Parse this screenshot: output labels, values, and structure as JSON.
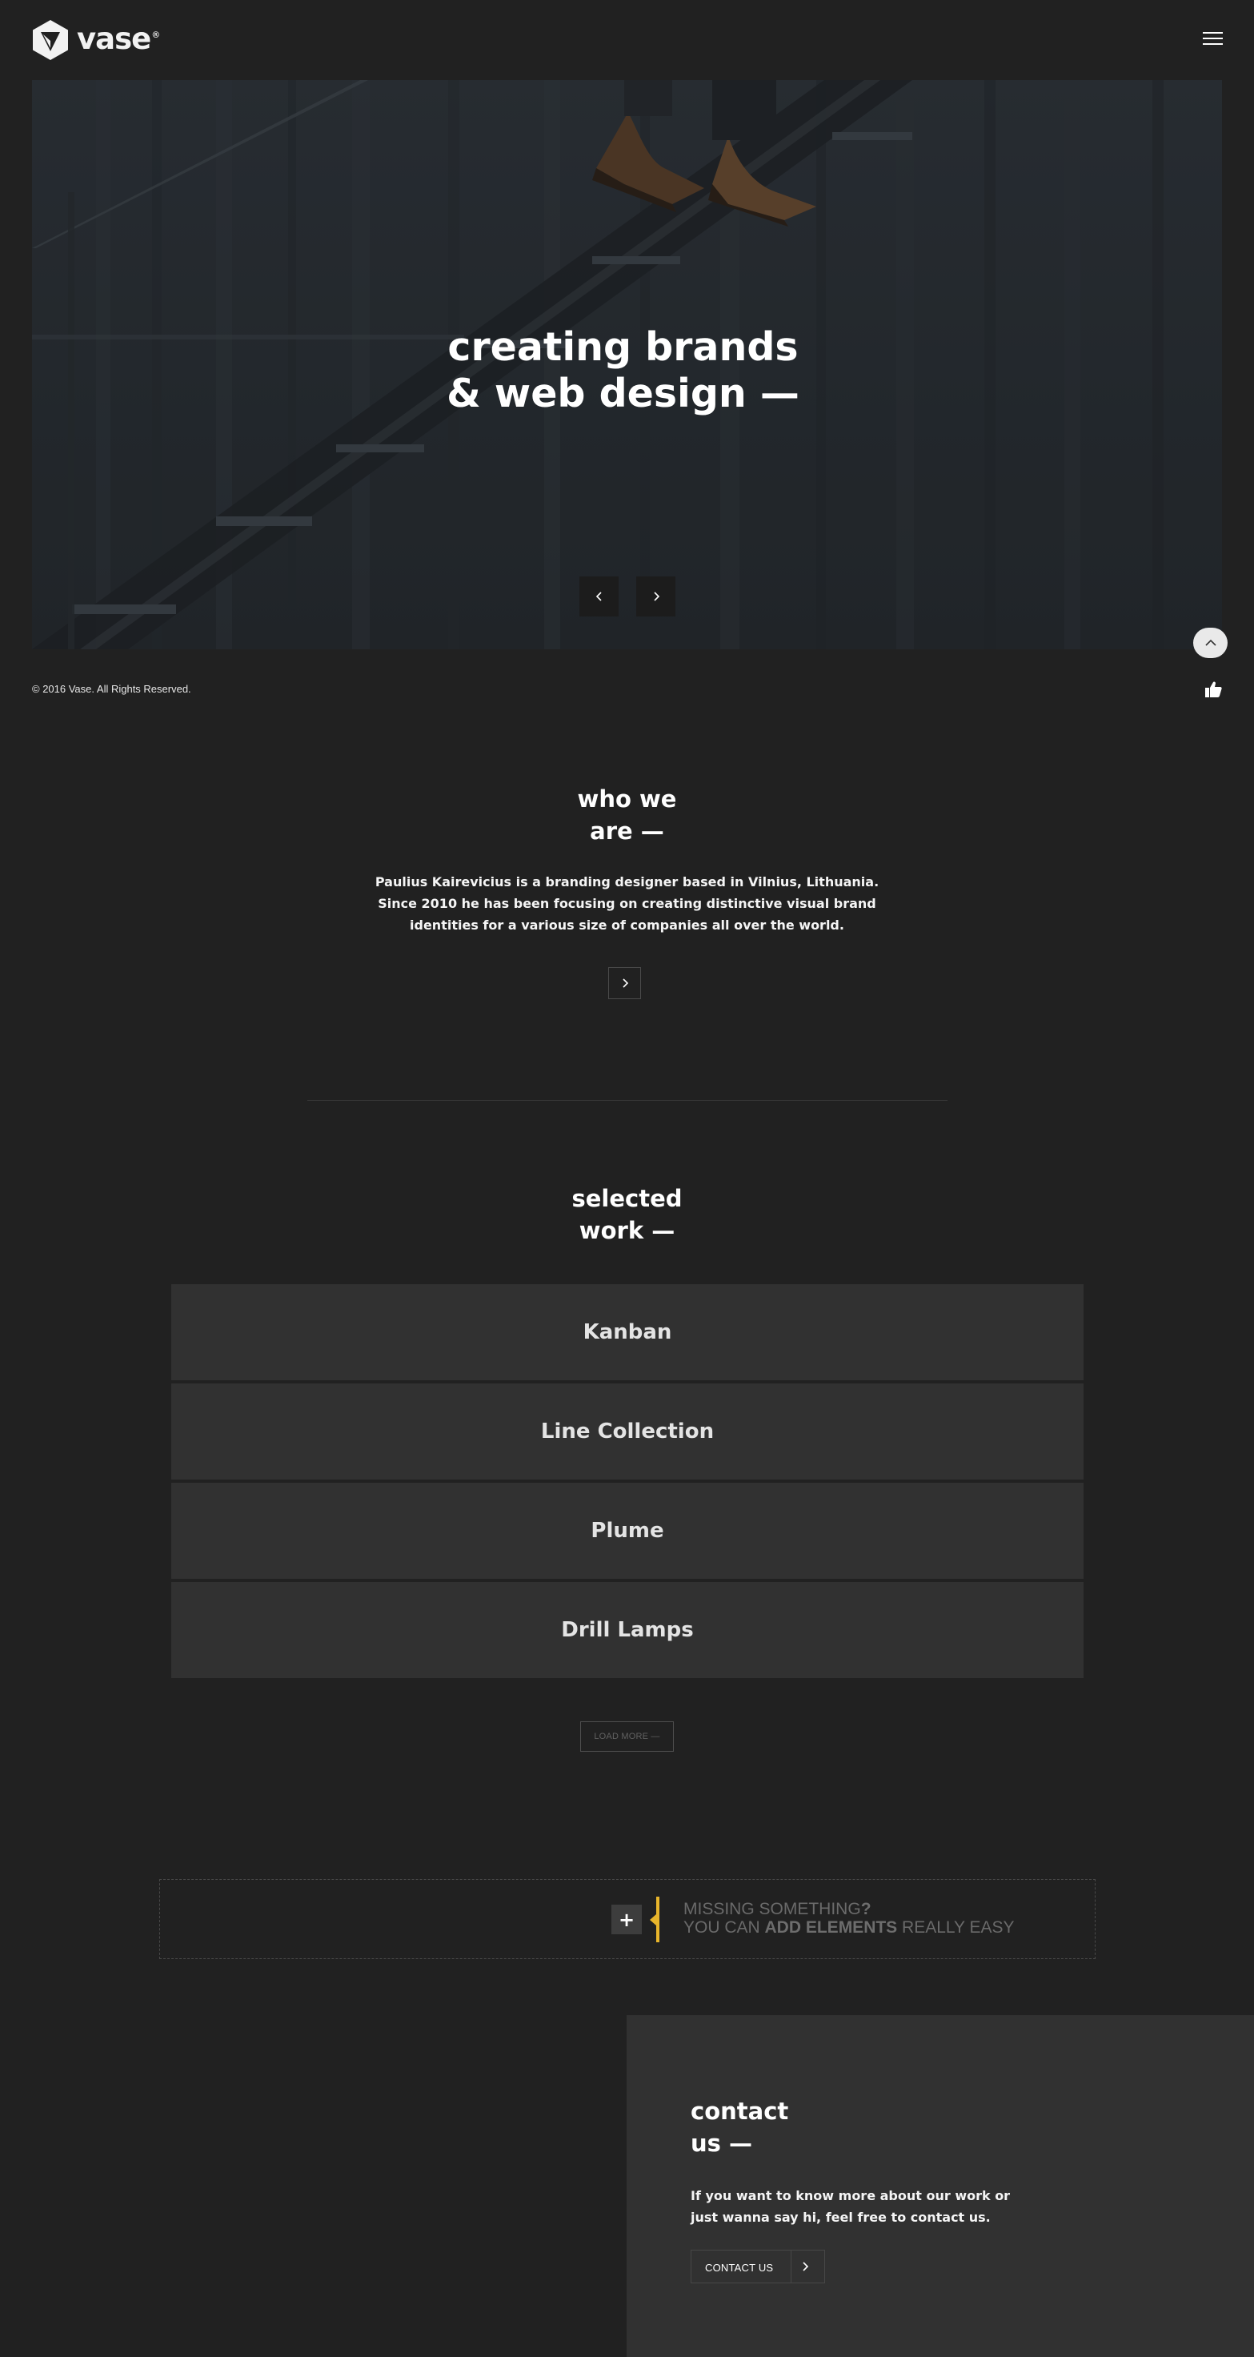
{
  "brand": {
    "name": "vase",
    "reg_mark": "®"
  },
  "hero": {
    "title_line1": "creating brands",
    "title_line2": "& web design —"
  },
  "footer": {
    "copyright": "© 2016 Vase. All Rights Reserved."
  },
  "about": {
    "title_line1": "who we",
    "title_line2": "are —",
    "text_line1": "Paulius Kairevicius is a branding designer based in Vilnius, Lithuania.",
    "text_line2": "Since 2010 he has been focusing on creating distinctive visual brand",
    "text_line3": "identities for a various size of companies all over the world."
  },
  "work": {
    "title_line1": "selected",
    "title_line2": "work —",
    "items": [
      {
        "label": "Kanban"
      },
      {
        "label": "Line Collection"
      },
      {
        "label": "Plume"
      },
      {
        "label": "Drill Lamps"
      }
    ],
    "load_more_label": "LOAD MORE —"
  },
  "builder": {
    "plus_label": "+",
    "line1_normal": "MISSING SOMETHING",
    "line1_bold": "?",
    "line2_normal_a": "YOU CAN ",
    "line2_bold": "ADD ELEMENTS",
    "line2_normal_b": " REALLY EASY",
    "accent_color": "#e8b52b"
  },
  "contact": {
    "title_line1": "contact",
    "title_line2": "us —",
    "text_line1": "If you want to know more about our work or",
    "text_line2": "just wanna say hi, feel free to contact us.",
    "button_label": "CONTACT US"
  },
  "colors": {
    "background": "#212121",
    "panel": "#313131",
    "text": "#ffffff"
  },
  "icons": {
    "logo": "vase-logo-icon",
    "menu": "hamburger-menu-icon",
    "prev": "chevron-left-icon",
    "next": "chevron-right-icon",
    "scroll_top": "chevron-up-icon",
    "like": "thumbs-up-icon"
  }
}
